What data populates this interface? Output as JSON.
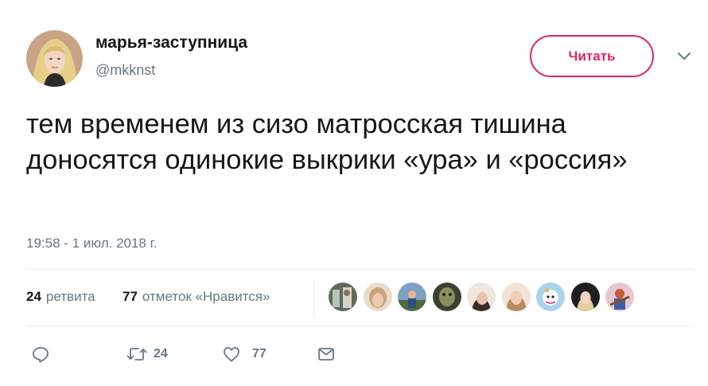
{
  "author": {
    "name": "марья-заступница",
    "handle": "@mkknst"
  },
  "follow_label": "Читать",
  "tweet": {
    "text": "тем временем из сизо матросская тишина доносятся одинокие выкрики «ура» и «россия»",
    "timestamp": "19:58 - 1 июл. 2018 г."
  },
  "stats": {
    "retweets_count": "24",
    "retweets_label": "ретвита",
    "likes_count": "77",
    "likes_label": "отметок «Нравится»"
  },
  "actions": {
    "retweet_count": "24",
    "like_count": "77"
  },
  "colors": {
    "accent": "#e0245e",
    "secondary_text": "#657786",
    "divider": "#e6ecf0"
  },
  "icons": [
    "reply-icon",
    "retweet-icon",
    "heart-icon",
    "message-icon",
    "chevron-down-icon"
  ]
}
